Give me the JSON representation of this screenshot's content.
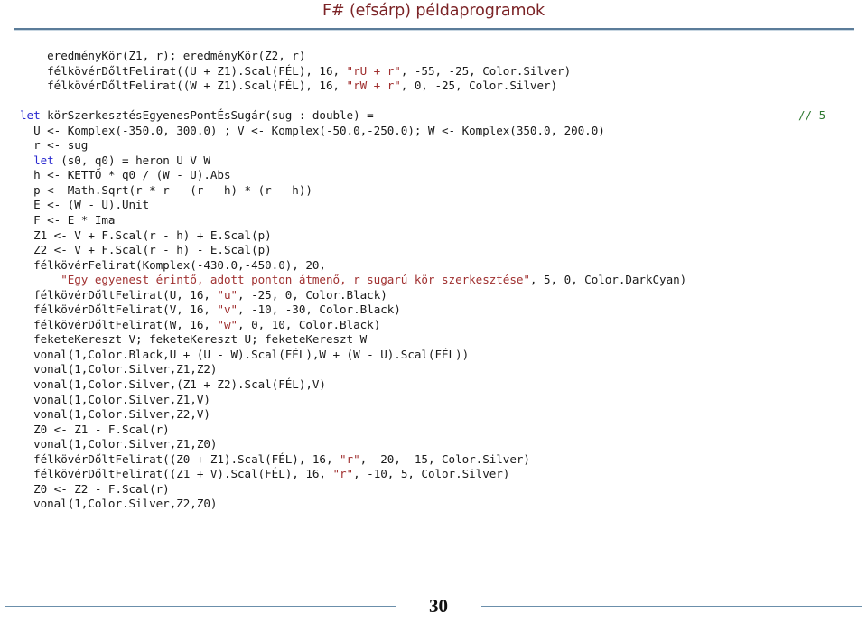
{
  "header": {
    "title": "F# (efsárp) példaprogramok"
  },
  "footer": {
    "page_number": "30"
  },
  "colors": {
    "title": "#7b2326",
    "rule": "#5b7c99",
    "keyword": "#2a2ad0",
    "string": "#a03030",
    "comment": "#2f7a32",
    "code_text": "#1a1a1a",
    "background": "#ffffff"
  },
  "code": {
    "language": "F#",
    "margin_comment": "// 5",
    "lines": [
      {
        "id": "l1",
        "segments": [
          {
            "t": "plain",
            "v": "    eredményKör(Z1, r); eredményKör(Z2, r)"
          }
        ]
      },
      {
        "id": "l2",
        "segments": [
          {
            "t": "plain",
            "v": "    félkövérDőltFelirat((U + Z1).Scal(FÉL), 16, "
          },
          {
            "t": "str",
            "v": "\"rU + r\""
          },
          {
            "t": "plain",
            "v": ", -55, -25, Color.Silver)"
          }
        ]
      },
      {
        "id": "l3",
        "segments": [
          {
            "t": "plain",
            "v": "    félkövérDőltFelirat((W + Z1).Scal(FÉL), 16, "
          },
          {
            "t": "str",
            "v": "\"rW + r\""
          },
          {
            "t": "plain",
            "v": ", 0, -25, Color.Silver)"
          }
        ]
      },
      {
        "id": "l4",
        "segments": [
          {
            "t": "plain",
            "v": ""
          }
        ]
      },
      {
        "id": "l5",
        "segments": [
          {
            "t": "kw",
            "v": "let"
          },
          {
            "t": "plain",
            "v": " körSzerkesztésEgyenesPontÉsSugár(sug : double) ="
          }
        ],
        "comment": "// 5"
      },
      {
        "id": "l6",
        "segments": [
          {
            "t": "plain",
            "v": "  U <- Komplex(-350.0, 300.0) ; V <- Komplex(-50.0,-250.0); W <- Komplex(350.0, 200.0)"
          }
        ]
      },
      {
        "id": "l7",
        "segments": [
          {
            "t": "plain",
            "v": "  r <- sug"
          }
        ]
      },
      {
        "id": "l8",
        "segments": [
          {
            "t": "plain",
            "v": "  "
          },
          {
            "t": "kw",
            "v": "let"
          },
          {
            "t": "plain",
            "v": " (s0, q0) = heron U V W"
          }
        ]
      },
      {
        "id": "l9",
        "segments": [
          {
            "t": "plain",
            "v": "  h <- KETTŐ * q0 / (W - U).Abs"
          }
        ]
      },
      {
        "id": "l10",
        "segments": [
          {
            "t": "plain",
            "v": "  p <- Math.Sqrt(r * r - (r - h) * (r - h))"
          }
        ]
      },
      {
        "id": "l11",
        "segments": [
          {
            "t": "plain",
            "v": "  E <- (W - U).Unit"
          }
        ]
      },
      {
        "id": "l12",
        "segments": [
          {
            "t": "plain",
            "v": "  F <- E * Ima"
          }
        ]
      },
      {
        "id": "l13",
        "segments": [
          {
            "t": "plain",
            "v": "  Z1 <- V + F.Scal(r - h) + E.Scal(p)"
          }
        ]
      },
      {
        "id": "l14",
        "segments": [
          {
            "t": "plain",
            "v": "  Z2 <- V + F.Scal(r - h) - E.Scal(p)"
          }
        ]
      },
      {
        "id": "l15",
        "segments": [
          {
            "t": "plain",
            "v": "  félkövérFelirat(Komplex(-430.0,-450.0), 20,"
          }
        ]
      },
      {
        "id": "l16",
        "segments": [
          {
            "t": "plain",
            "v": "      "
          },
          {
            "t": "str",
            "v": "\"Egy egyenest érintő, adott ponton átmenő, r sugarú kör szerkesztése\""
          },
          {
            "t": "plain",
            "v": ", 5, 0, Color.DarkCyan)"
          }
        ]
      },
      {
        "id": "l17",
        "segments": [
          {
            "t": "plain",
            "v": "  félkövérDőltFelirat(U, 16, "
          },
          {
            "t": "str",
            "v": "\"u\""
          },
          {
            "t": "plain",
            "v": ", -25, 0, Color.Black)"
          }
        ]
      },
      {
        "id": "l18",
        "segments": [
          {
            "t": "plain",
            "v": "  félkövérDőltFelirat(V, 16, "
          },
          {
            "t": "str",
            "v": "\"v\""
          },
          {
            "t": "plain",
            "v": ", -10, -30, Color.Black)"
          }
        ]
      },
      {
        "id": "l19",
        "segments": [
          {
            "t": "plain",
            "v": "  félkövérDőltFelirat(W, 16, "
          },
          {
            "t": "str",
            "v": "\"w\""
          },
          {
            "t": "plain",
            "v": ", 0, 10, Color.Black)"
          }
        ]
      },
      {
        "id": "l20",
        "segments": [
          {
            "t": "plain",
            "v": "  feketeKereszt V; feketeKereszt U; feketeKereszt W"
          }
        ]
      },
      {
        "id": "l21",
        "segments": [
          {
            "t": "plain",
            "v": "  vonal(1,Color.Black,U + (U - W).Scal(FÉL),W + (W - U).Scal(FÉL))"
          }
        ]
      },
      {
        "id": "l22",
        "segments": [
          {
            "t": "plain",
            "v": "  vonal(1,Color.Silver,Z1,Z2)"
          }
        ]
      },
      {
        "id": "l23",
        "segments": [
          {
            "t": "plain",
            "v": "  vonal(1,Color.Silver,(Z1 + Z2).Scal(FÉL),V)"
          }
        ]
      },
      {
        "id": "l24",
        "segments": [
          {
            "t": "plain",
            "v": "  vonal(1,Color.Silver,Z1,V)"
          }
        ]
      },
      {
        "id": "l25",
        "segments": [
          {
            "t": "plain",
            "v": "  vonal(1,Color.Silver,Z2,V)"
          }
        ]
      },
      {
        "id": "l26",
        "segments": [
          {
            "t": "plain",
            "v": "  Z0 <- Z1 - F.Scal(r)"
          }
        ]
      },
      {
        "id": "l27",
        "segments": [
          {
            "t": "plain",
            "v": "  vonal(1,Color.Silver,Z1,Z0)"
          }
        ]
      },
      {
        "id": "l28",
        "segments": [
          {
            "t": "plain",
            "v": "  félkövérDőltFelirat((Z0 + Z1).Scal(FÉL), 16, "
          },
          {
            "t": "str",
            "v": "\"r\""
          },
          {
            "t": "plain",
            "v": ", -20, -15, Color.Silver)"
          }
        ]
      },
      {
        "id": "l29",
        "segments": [
          {
            "t": "plain",
            "v": "  félkövérDőltFelirat((Z1 + V).Scal(FÉL), 16, "
          },
          {
            "t": "str",
            "v": "\"r\""
          },
          {
            "t": "plain",
            "v": ", -10, 5, Color.Silver)"
          }
        ]
      },
      {
        "id": "l30",
        "segments": [
          {
            "t": "plain",
            "v": "  Z0 <- Z2 - F.Scal(r)"
          }
        ]
      },
      {
        "id": "l31",
        "segments": [
          {
            "t": "plain",
            "v": "  vonal(1,Color.Silver,Z2,Z0)"
          }
        ]
      }
    ]
  }
}
